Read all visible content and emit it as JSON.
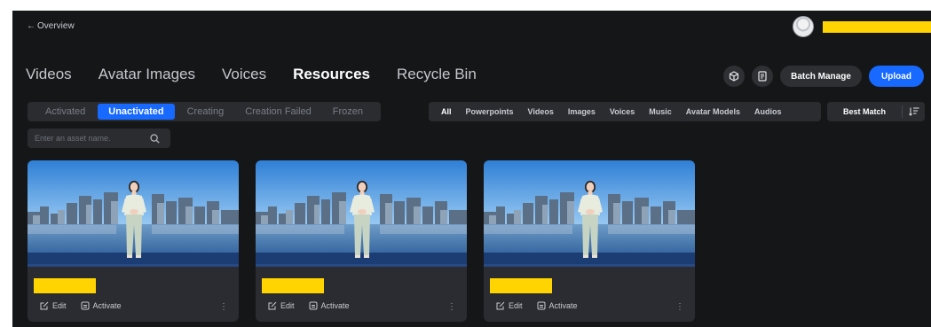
{
  "header": {
    "back_label": "Overview"
  },
  "main_tabs": [
    {
      "label": "Videos",
      "active": false
    },
    {
      "label": "Avatar Images",
      "active": false
    },
    {
      "label": "Voices",
      "active": false
    },
    {
      "label": "Resources",
      "active": true
    },
    {
      "label": "Recycle Bin",
      "active": false
    }
  ],
  "actions": {
    "batch_manage": "Batch Manage",
    "upload": "Upload"
  },
  "status_tabs": [
    {
      "label": "Activated",
      "active": false
    },
    {
      "label": "Unactivated",
      "active": true
    },
    {
      "label": "Creating",
      "active": false
    },
    {
      "label": "Creation Failed",
      "active": false
    },
    {
      "label": "Frozen",
      "active": false
    }
  ],
  "type_tabs": [
    {
      "label": "All",
      "active": true
    },
    {
      "label": "Powerpoints",
      "active": false
    },
    {
      "label": "Videos",
      "active": false
    },
    {
      "label": "Images",
      "active": false
    },
    {
      "label": "Voices",
      "active": false
    },
    {
      "label": "Music",
      "active": false
    },
    {
      "label": "Avatar Models",
      "active": false
    },
    {
      "label": "Audios",
      "active": false
    }
  ],
  "sort": {
    "label": "Best Match"
  },
  "search": {
    "placeholder": "Enter an asset name."
  },
  "cards": [
    {
      "edit_label": "Edit",
      "activate_label": "Activate",
      "more_label": "⋮"
    },
    {
      "edit_label": "Edit",
      "activate_label": "Activate",
      "more_label": "⋮"
    },
    {
      "edit_label": "Edit",
      "activate_label": "Activate",
      "more_label": "⋮"
    }
  ],
  "colors": {
    "accent": "#1769ff",
    "background": "#151618",
    "redaction": "#ffd400"
  }
}
